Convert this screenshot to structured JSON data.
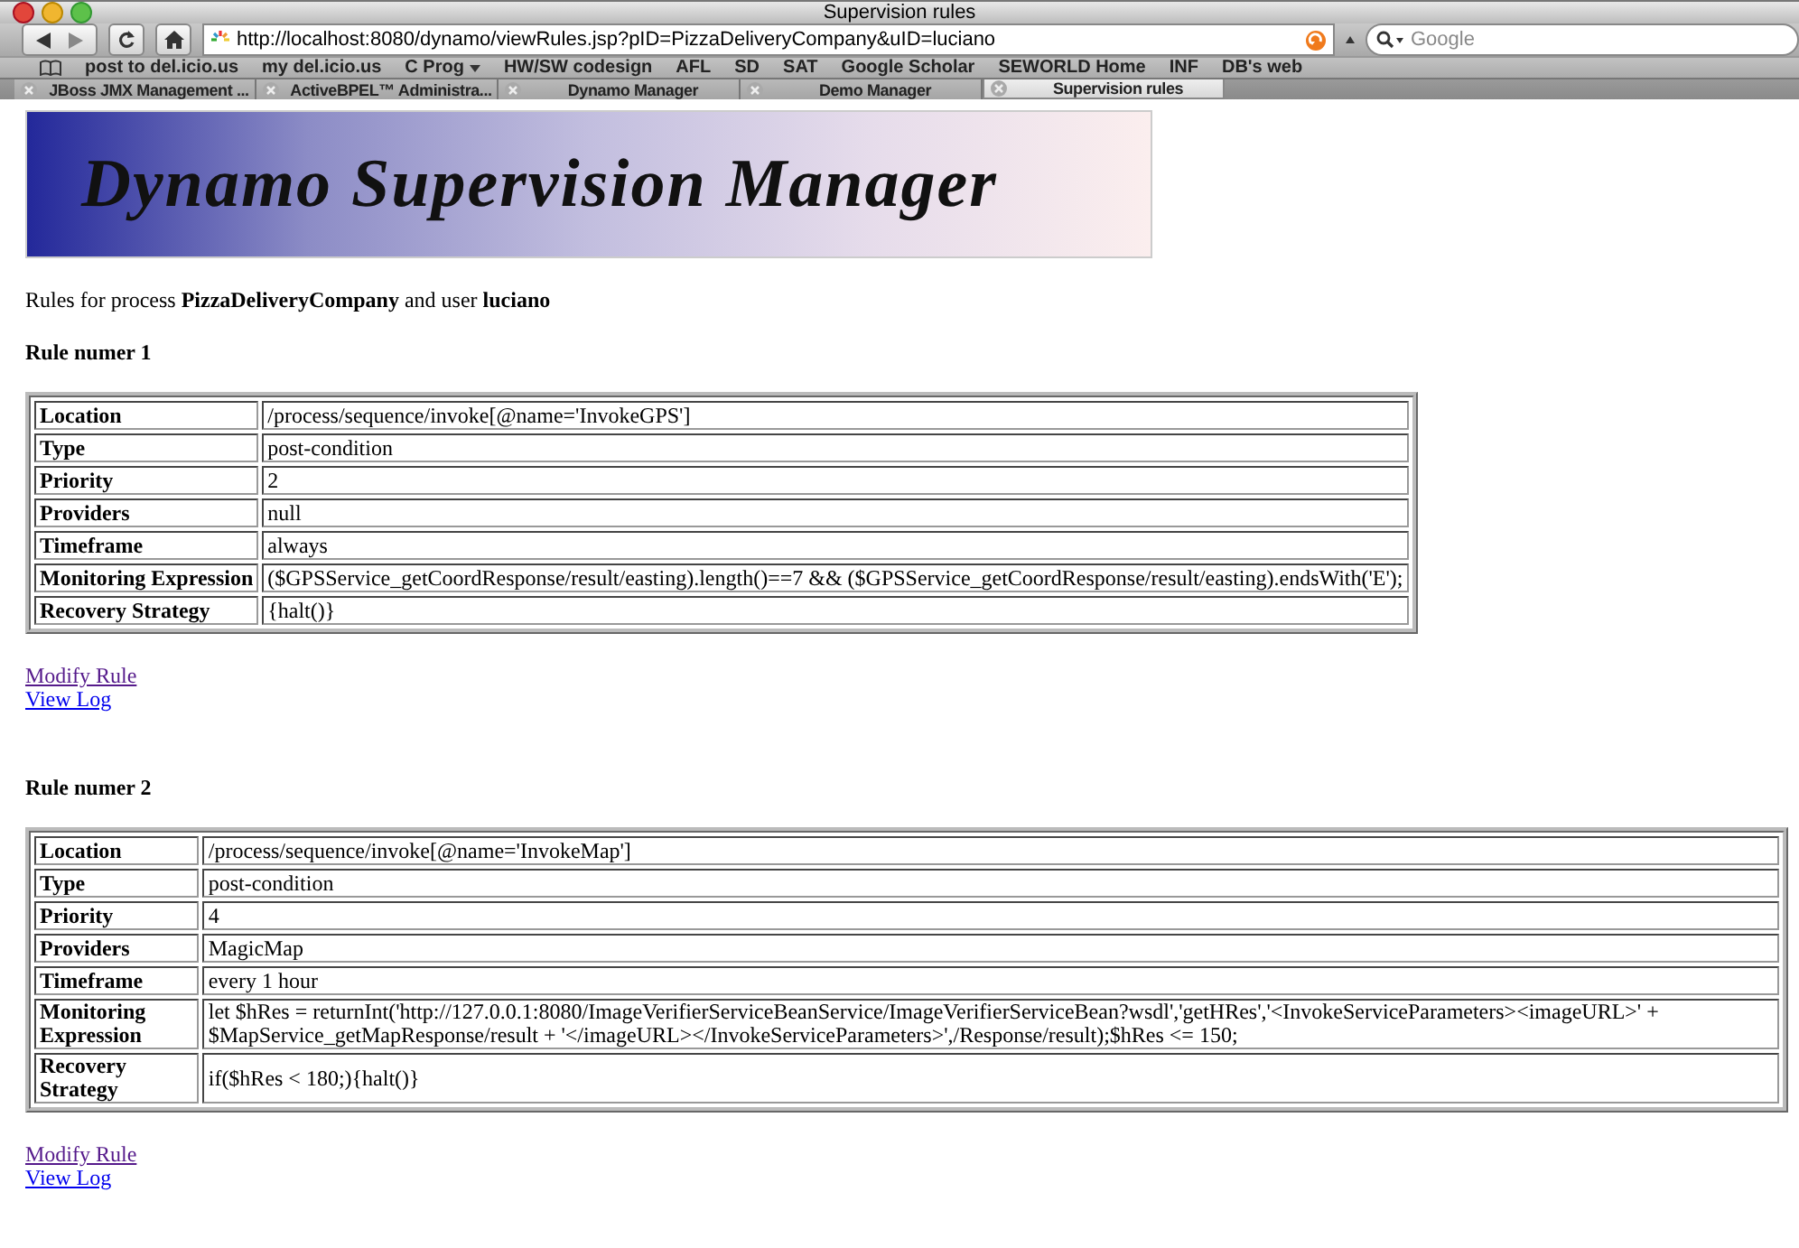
{
  "window": {
    "title": "Supervision rules"
  },
  "toolbar": {
    "url": "http://localhost:8080/dynamo/viewRules.jsp?pID=PizzaDeliveryCompany&uID=luciano",
    "search": {
      "placeholder": "Google"
    }
  },
  "bookmarks": [
    {
      "label": "post to del.icio.us",
      "kind": "link"
    },
    {
      "label": "my del.icio.us",
      "kind": "link"
    },
    {
      "label": "C Prog",
      "kind": "menu"
    },
    {
      "label": "HW/SW codesign",
      "kind": "link"
    },
    {
      "label": "AFL",
      "kind": "link"
    },
    {
      "label": "SD",
      "kind": "link"
    },
    {
      "label": "SAT",
      "kind": "link"
    },
    {
      "label": "Google Scholar",
      "kind": "link"
    },
    {
      "label": "SEWORLD Home",
      "kind": "link"
    },
    {
      "label": "INF",
      "kind": "link"
    },
    {
      "label": "DB's web",
      "kind": "link"
    }
  ],
  "tabs": [
    {
      "label": "JBoss JMX Management ...",
      "selected": false
    },
    {
      "label": "ActiveBPEL™ Administra...",
      "selected": false
    },
    {
      "label": "Dynamo Manager",
      "selected": false
    },
    {
      "label": "Demo Manager",
      "selected": false
    },
    {
      "label": "Supervision rules",
      "selected": true
    }
  ],
  "page": {
    "banner": {
      "title": "Dynamo Supervision Manager"
    },
    "intro": "Rules for process **PizzaDeliveryCompany** and user **luciano**",
    "rules": [
      {
        "heading": "Rule numer 1",
        "rows": [
          {
            "label": "Location",
            "value": "/process/sequence/invoke[@name='InvokeGPS']"
          },
          {
            "label": "Type",
            "value": "post-condition"
          },
          {
            "label": "Priority",
            "value": "2"
          },
          {
            "label": "Providers",
            "value": "null"
          },
          {
            "label": "Timeframe",
            "value": "always"
          },
          {
            "label": "Monitoring Expression",
            "value": "($GPSService_getCoordResponse/result/easting).length()==7 && ($GPSService_getCoordResponse/result/easting).endsWith('E');"
          },
          {
            "label": "Recovery Strategy",
            "value": "{halt()}"
          }
        ],
        "links": [
          {
            "label": "Modify Rule",
            "visited": true
          },
          {
            "label": "View Log",
            "visited": false
          }
        ]
      },
      {
        "heading": "Rule numer 2",
        "rows": [
          {
            "label": "Location",
            "value": "/process/sequence/invoke[@name='InvokeMap']"
          },
          {
            "label": "Type",
            "value": "post-condition"
          },
          {
            "label": "Priority",
            "value": "4"
          },
          {
            "label": "Providers",
            "value": "MagicMap"
          },
          {
            "label": "Timeframe",
            "value": "every 1 hour"
          },
          {
            "label": "Monitoring Expression",
            "value": "let $hRes = returnInt('http://127.0.0.1:8080/ImageVerifierServiceBeanService/ImageVerifierServiceBean?wsdl','getHRes','<InvokeServiceParameters><imageURL>' + $MapService_getMapResponse/result + '</imageURL></InvokeServiceParameters>',/Response/result);$hRes <= 150;"
          },
          {
            "label": "Recovery Strategy",
            "value": "if($hRes < 180;){halt()}"
          }
        ],
        "links": [
          {
            "label": "Modify Rule",
            "visited": true
          },
          {
            "label": "View Log",
            "visited": false
          }
        ]
      }
    ]
  }
}
